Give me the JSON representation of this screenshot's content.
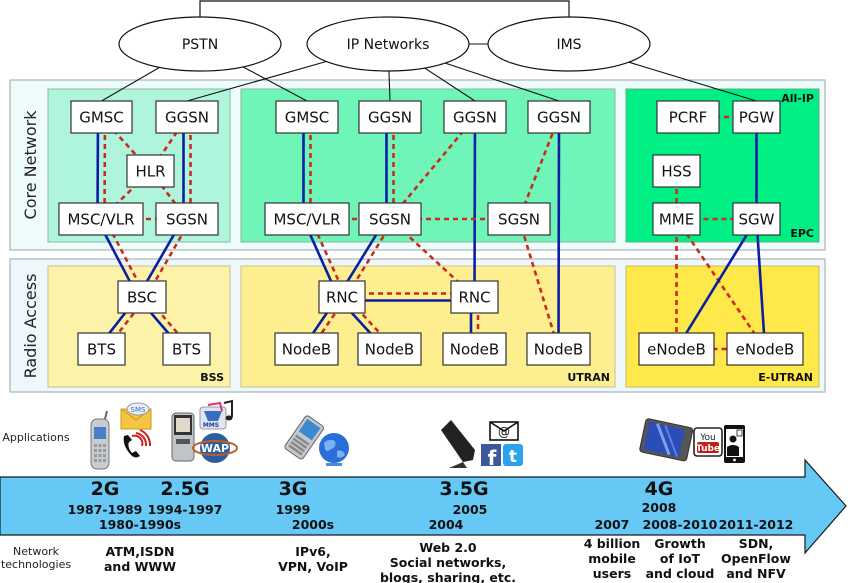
{
  "clouds": [
    {
      "id": "pstn",
      "label": "PSTN"
    },
    {
      "id": "ipnet",
      "label": "IP Networks"
    },
    {
      "id": "ims",
      "label": "IMS"
    }
  ],
  "side_labels": {
    "core": "Core Network",
    "radio": "Radio Access"
  },
  "region_tags": {
    "all_ip": "All-IP",
    "epc": "EPC",
    "bss": "BSS",
    "utran": "UTRAN",
    "eutran": "E-UTRAN"
  },
  "colors": {
    "core_band": "#eefdfb",
    "radio_band": "#eefaff",
    "g2_core": "#aef5dc",
    "g3_core": "#6ff5b8",
    "g4_core": "#00ef85",
    "g2_radio": "#fdf3a8",
    "g3_radio": "#fdef90",
    "g4_radio": "#ffe84a",
    "user_plane": "#0a1fa5",
    "control_plane": "#cc2a1e",
    "arrow_fill": "#66c8f5"
  },
  "nodes": [
    {
      "id": "g2_gmsc",
      "label": "GMSC"
    },
    {
      "id": "g2_ggsn",
      "label": "GGSN"
    },
    {
      "id": "g2_hlr",
      "label": "HLR"
    },
    {
      "id": "g2_msc",
      "label": "MSC/VLR"
    },
    {
      "id": "g2_sgsn",
      "label": "SGSN"
    },
    {
      "id": "g2_bsc",
      "label": "BSC"
    },
    {
      "id": "g2_bts1",
      "label": "BTS"
    },
    {
      "id": "g2_bts2",
      "label": "BTS"
    },
    {
      "id": "g3_gmsc",
      "label": "GMSC"
    },
    {
      "id": "g3_ggsn1",
      "label": "GGSN"
    },
    {
      "id": "g3_ggsn2",
      "label": "GGSN"
    },
    {
      "id": "g3_ggsn3",
      "label": "GGSN"
    },
    {
      "id": "g3_msc",
      "label": "MSC/VLR"
    },
    {
      "id": "g3_sgsn1",
      "label": "SGSN"
    },
    {
      "id": "g3_sgsn2",
      "label": "SGSN"
    },
    {
      "id": "g3_rnc1",
      "label": "RNC"
    },
    {
      "id": "g3_rnc2",
      "label": "RNC"
    },
    {
      "id": "g3_nb1",
      "label": "NodeB"
    },
    {
      "id": "g3_nb2",
      "label": "NodeB"
    },
    {
      "id": "g3_nb3",
      "label": "NodeB"
    },
    {
      "id": "g3_nb4",
      "label": "NodeB"
    },
    {
      "id": "g4_pcrf",
      "label": "PCRF"
    },
    {
      "id": "g4_pgw",
      "label": "PGW"
    },
    {
      "id": "g4_hss",
      "label": "HSS"
    },
    {
      "id": "g4_mme",
      "label": "MME"
    },
    {
      "id": "g4_sgw",
      "label": "SGW"
    },
    {
      "id": "g4_enb1",
      "label": "eNodeB"
    },
    {
      "id": "g4_enb2",
      "label": "eNodeB"
    }
  ],
  "links": [
    {
      "from": "g2_gmsc",
      "to": "g2_msc",
      "type": "user"
    },
    {
      "from": "g2_gmsc",
      "to": "g2_msc",
      "type": "control"
    },
    {
      "from": "g2_ggsn",
      "to": "g2_sgsn",
      "type": "user"
    },
    {
      "from": "g2_ggsn",
      "to": "g2_sgsn",
      "type": "control"
    },
    {
      "from": "g2_gmsc",
      "to": "g2_hlr",
      "type": "control"
    },
    {
      "from": "g2_ggsn",
      "to": "g2_hlr",
      "type": "control"
    },
    {
      "from": "g2_hlr",
      "to": "g2_msc",
      "type": "control"
    },
    {
      "from": "g2_hlr",
      "to": "g2_sgsn",
      "type": "control"
    },
    {
      "from": "g2_msc",
      "to": "g2_sgsn",
      "type": "control"
    },
    {
      "from": "g2_msc",
      "to": "g2_bsc",
      "type": "user"
    },
    {
      "from": "g2_msc",
      "to": "g2_bsc",
      "type": "control"
    },
    {
      "from": "g2_sgsn",
      "to": "g2_bsc",
      "type": "user"
    },
    {
      "from": "g2_sgsn",
      "to": "g2_bsc",
      "type": "control"
    },
    {
      "from": "g2_bsc",
      "to": "g2_bts1",
      "type": "user"
    },
    {
      "from": "g2_bsc",
      "to": "g2_bts1",
      "type": "control"
    },
    {
      "from": "g2_bsc",
      "to": "g2_bts2",
      "type": "user"
    },
    {
      "from": "g2_bsc",
      "to": "g2_bts2",
      "type": "control"
    },
    {
      "from": "g3_gmsc",
      "to": "g3_msc",
      "type": "user"
    },
    {
      "from": "g3_gmsc",
      "to": "g3_msc",
      "type": "control"
    },
    {
      "from": "g3_ggsn1",
      "to": "g3_sgsn1",
      "type": "user"
    },
    {
      "from": "g3_ggsn1",
      "to": "g3_sgsn1",
      "type": "control"
    },
    {
      "from": "g3_ggsn2",
      "to": "g3_sgsn1",
      "type": "control"
    },
    {
      "from": "g3_ggsn2",
      "to": "g3_rnc2",
      "type": "user"
    },
    {
      "from": "g3_ggsn3",
      "to": "g3_sgsn2",
      "type": "control"
    },
    {
      "from": "g3_ggsn3",
      "to": "g3_nb4",
      "type": "user"
    },
    {
      "from": "g3_msc",
      "to": "g3_sgsn1",
      "type": "control"
    },
    {
      "from": "g3_sgsn1",
      "to": "g3_sgsn2",
      "type": "control"
    },
    {
      "from": "g3_msc",
      "to": "g3_rnc1",
      "type": "user"
    },
    {
      "from": "g3_msc",
      "to": "g3_rnc1",
      "type": "control"
    },
    {
      "from": "g3_sgsn1",
      "to": "g3_rnc1",
      "type": "user"
    },
    {
      "from": "g3_sgsn1",
      "to": "g3_rnc1",
      "type": "control"
    },
    {
      "from": "g3_sgsn1",
      "to": "g3_rnc2",
      "type": "control"
    },
    {
      "from": "g3_sgsn2",
      "to": "g3_nb4",
      "type": "control"
    },
    {
      "from": "g3_rnc1",
      "to": "g3_rnc2",
      "type": "user"
    },
    {
      "from": "g3_rnc1",
      "to": "g3_rnc2",
      "type": "control"
    },
    {
      "from": "g3_rnc1",
      "to": "g3_nb1",
      "type": "user"
    },
    {
      "from": "g3_rnc1",
      "to": "g3_nb1",
      "type": "control"
    },
    {
      "from": "g3_rnc1",
      "to": "g3_nb2",
      "type": "user"
    },
    {
      "from": "g3_rnc1",
      "to": "g3_nb2",
      "type": "control"
    },
    {
      "from": "g3_rnc2",
      "to": "g3_nb3",
      "type": "user"
    },
    {
      "from": "g3_rnc2",
      "to": "g3_nb3",
      "type": "control"
    },
    {
      "from": "g4_pcrf",
      "to": "g4_pgw",
      "type": "control"
    },
    {
      "from": "g4_pgw",
      "to": "g4_sgw",
      "type": "user"
    },
    {
      "from": "g4_hss",
      "to": "g4_mme",
      "type": "control"
    },
    {
      "from": "g4_mme",
      "to": "g4_sgw",
      "type": "control"
    },
    {
      "from": "g4_mme",
      "to": "g4_enb1",
      "type": "control"
    },
    {
      "from": "g4_mme",
      "to": "g4_enb2",
      "type": "control"
    },
    {
      "from": "g4_sgw",
      "to": "g4_enb1",
      "type": "user"
    },
    {
      "from": "g4_sgw",
      "to": "g4_enb2",
      "type": "user"
    },
    {
      "from": "g4_enb1",
      "to": "g4_enb2",
      "type": "control"
    }
  ],
  "cloud_links": [
    {
      "from": "pstn",
      "to": "g2_gmsc"
    },
    {
      "from": "pstn",
      "to": "g3_gmsc"
    },
    {
      "from": "ipnet",
      "to": "g2_ggsn"
    },
    {
      "from": "ipnet",
      "to": "g3_ggsn1"
    },
    {
      "from": "ipnet",
      "to": "g3_ggsn2"
    },
    {
      "from": "ipnet",
      "to": "g3_ggsn3"
    },
    {
      "from": "ipnet",
      "to": "ims"
    },
    {
      "from": "ims",
      "to": "g4_pgw"
    },
    {
      "from": "pstn",
      "to": "ims",
      "kind": "top-bracket"
    }
  ],
  "timeline": {
    "applications_caption": "Applications",
    "network_tech_caption": "Network technologies",
    "generations": [
      {
        "id": "2g",
        "label": "2G",
        "year": "1987-1989",
        "era": "1980-1990s",
        "tech": [
          "ATM,ISDN",
          "and WWW"
        ],
        "apps": [
          "feature-phone-icon",
          "sms-icon",
          "voice-call-icon"
        ]
      },
      {
        "id": "2_5g",
        "label": "2.5G",
        "year": "1994-1997",
        "era": "",
        "tech": [],
        "apps": [
          "candybar-phone-icon",
          "mms-icon",
          "wap-icon"
        ]
      },
      {
        "id": "3g",
        "label": "3G",
        "year": "1999",
        "era": "2000s",
        "tech": [
          "IPv6,",
          "VPN, VoIP"
        ],
        "apps": [
          "smartphone-icon",
          "globe-icon"
        ]
      },
      {
        "id": "3_5g",
        "label": "3.5G",
        "year": "2005",
        "era": "2004",
        "tech": [
          "Web 2.0",
          "Social networks,",
          "blogs, sharing, etc."
        ],
        "apps": [
          "touch-phone-icon",
          "email-icon",
          "facebook-icon",
          "twitter-icon"
        ]
      },
      {
        "id": "4g",
        "label": "4G",
        "year": "2008",
        "era": "",
        "tech": [],
        "apps": [
          "tablet-icon",
          "youtube-icon",
          "video-call-icon"
        ]
      }
    ],
    "milestones": [
      {
        "year": "2007",
        "tech": [
          "4 billion",
          "mobile",
          "users"
        ]
      },
      {
        "year": "2008-2010",
        "tech": [
          "Growth",
          "of IoT",
          "and cloud"
        ]
      },
      {
        "year": "2011-2012",
        "tech": [
          "SDN,",
          "OpenFlow",
          "and NFV"
        ]
      }
    ]
  }
}
